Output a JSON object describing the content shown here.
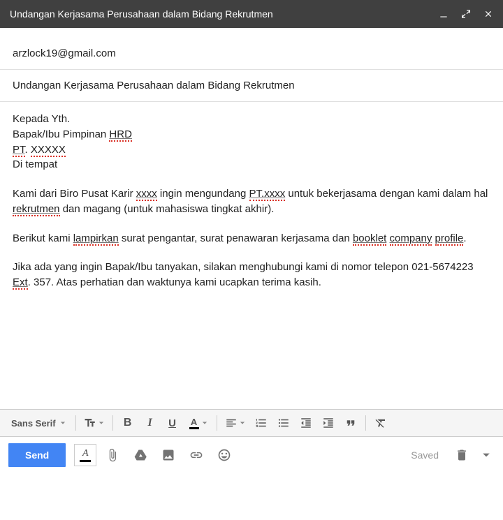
{
  "titlebar": {
    "title": "Undangan Kerjasama Perusahaan dalam Bidang Rekrutmen"
  },
  "to": "arzlock19@gmail.com",
  "subject": "Undangan Kerjasama Perusahaan dalam Bidang Rekrutmen",
  "body": {
    "greeting_l1": "Kepada Yth.",
    "greeting_l2a": "Bapak/Ibu Pimpinan ",
    "greeting_l2b": "HRD",
    "greeting_l3a": "PT",
    "greeting_l3b": ". ",
    "greeting_l3c": "XXXXX",
    "greeting_l4": "Di tempat",
    "p1a": "Kami dari Biro Pusat Karir ",
    "p1b": "xxxx",
    "p1c": " ingin mengundang ",
    "p1d": "PT.xxxx",
    "p1e": " untuk bekerjasama dengan kami dalam hal ",
    "p1f": "rekrutmen",
    "p1g": " dan magang (untuk mahasiswa tingkat akhir).",
    "p2a": "Berikut kami ",
    "p2b": "lampirkan",
    "p2c": " surat pengantar, surat penawaran kerjasama dan ",
    "p2d": "booklet",
    "p2e": " ",
    "p2f": "company",
    "p2g": " ",
    "p2h": "profile",
    "p2i": ".",
    "p3a": "Jika ada yang ingin Bapak/Ibu tanyakan, silakan menghubungi kami di nomor telepon 021-5674223 ",
    "p3b": "Ext",
    "p3c": ". 357. Atas perhatian dan waktunya kami ucapkan terima kasih."
  },
  "format": {
    "font_family": "Sans Serif",
    "size_label": "T",
    "bold": "B",
    "italic": "I",
    "underline": "U",
    "textcolor": "A"
  },
  "bottom": {
    "send": "Send",
    "saved": "Saved"
  }
}
